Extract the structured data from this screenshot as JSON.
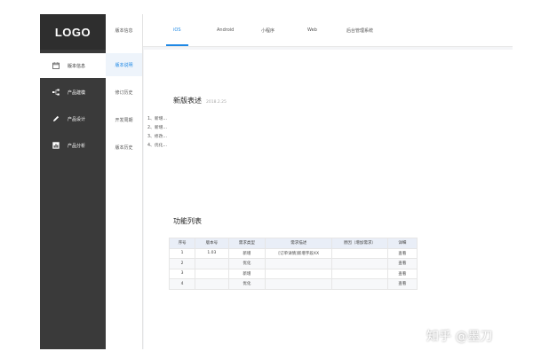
{
  "sidebar": {
    "logo": "LOGO",
    "items": [
      {
        "label": "版本信息",
        "icon": "calendar-icon",
        "active": true
      },
      {
        "label": "产品建模",
        "icon": "hierarchy-icon",
        "active": false
      },
      {
        "label": "产品设计",
        "icon": "pencil-icon",
        "active": false
      },
      {
        "label": "产品分析",
        "icon": "chart-icon",
        "active": false
      }
    ]
  },
  "subnav": {
    "header": "版本信息",
    "items": [
      "版本说明",
      "修订历史",
      "开发周期",
      "版本历史"
    ]
  },
  "tabs": [
    "iOS",
    "Android",
    "小程序",
    "Web",
    "后台管理系统"
  ],
  "release": {
    "title": "新版表述",
    "date": "2018.2.25",
    "items": [
      "1、新增...",
      "2、新增...",
      "3、修改...",
      "4、优化..."
    ]
  },
  "features": {
    "title": "功能列表",
    "headers": [
      "序号",
      "版本号",
      "需求类型",
      "需求描述",
      "原因（增加需求）",
      "详细"
    ],
    "rows": [
      [
        "1",
        "1.03",
        "新增",
        "[订单详情]新增字段XX",
        "",
        "查看"
      ],
      [
        "2",
        "",
        "优化",
        "",
        "",
        "查看"
      ],
      [
        "3",
        "",
        "新增",
        "",
        "",
        "查看"
      ],
      [
        "4",
        "",
        "优化",
        "",
        "",
        "查看"
      ]
    ]
  },
  "watermark": "知乎 @墨刀",
  "colors": {
    "accent": "#1e88e5",
    "sidebar": "#3a3a3a",
    "logo_bg": "#2e2e2e"
  }
}
